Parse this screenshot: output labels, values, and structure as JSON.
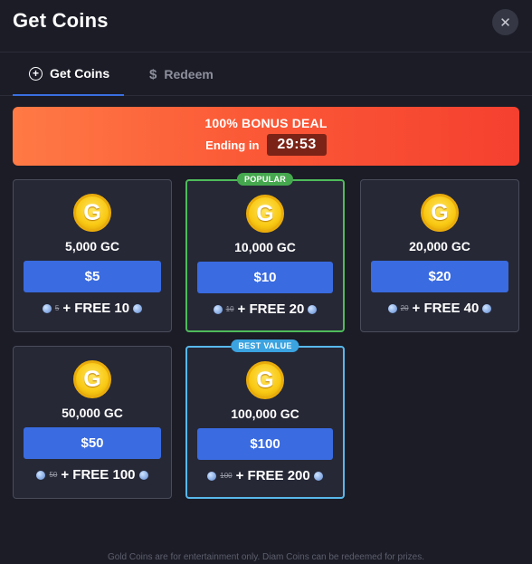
{
  "header": {
    "title": "Get Coins",
    "close_icon": "✕"
  },
  "tabs": [
    {
      "label": "Get Coins",
      "icon": "plus-circle-icon",
      "active": true
    },
    {
      "label": "Redeem",
      "icon": "dollar-icon",
      "active": false
    }
  ],
  "banner": {
    "title": "100% BONUS DEAL",
    "ending_label": "Ending in",
    "timer": "29:53"
  },
  "cards": [
    {
      "coin_letter": "G",
      "amount": "5,000 GC",
      "price": "$5",
      "old_value": "5",
      "bonus": "+ FREE 10",
      "tag": ""
    },
    {
      "coin_letter": "G",
      "amount": "10,000 GC",
      "price": "$10",
      "old_value": "10",
      "bonus": "+ FREE 20",
      "tag": "POPULAR"
    },
    {
      "coin_letter": "G",
      "amount": "20,000 GC",
      "price": "$20",
      "old_value": "20",
      "bonus": "+ FREE 40",
      "tag": ""
    },
    {
      "coin_letter": "G",
      "amount": "50,000 GC",
      "price": "$50",
      "old_value": "50",
      "bonus": "+ FREE 100",
      "tag": ""
    },
    {
      "coin_letter": "G",
      "amount": "100,000 GC",
      "price": "$100",
      "old_value": "100",
      "bonus": "+ FREE 200",
      "tag": "BEST VALUE"
    }
  ],
  "footer": {
    "text": "Gold Coins are for entertainment only. Diam Coins can be redeemed for prizes."
  },
  "colors": {
    "background": "#1b1c26",
    "accent_blue": "#3a6be0",
    "popular_green": "#4fbb5b",
    "best_value_blue": "#58b8ea",
    "banner_orange": "#fb5a37"
  }
}
